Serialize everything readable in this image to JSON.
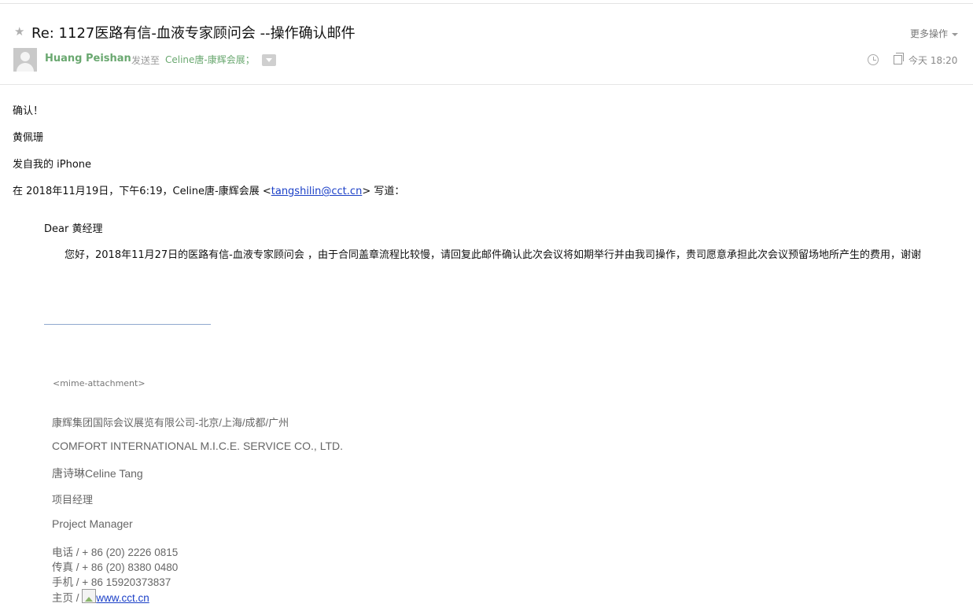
{
  "email": {
    "subject": "Re: 1127医路有信-血液专家顾问会 --操作确认邮件",
    "more_actions_label": "更多操作",
    "sender_name": "Huang Peishan",
    "sent_to_label": "发送至",
    "recipient": "Celine唐-康辉会展；",
    "time": "今天 18:20"
  },
  "body": {
    "line1": "确认！",
    "line2": "黄佩珊",
    "line3": "发自我的 iPhone",
    "reply_prefix": "在 2018年11月19日，下午6:19，Celine唐-康辉会展 <",
    "reply_email": "tangshilin@cct.cn",
    "reply_suffix": "> 写道：",
    "quote_greeting": "Dear 黄经理",
    "quote_paragraph": "您好，2018年11月27日的医路有信-血液专家顾问会 ，由于合同盖章流程比较慢，请回复此邮件确认此次会议将如期举行并由我司操作，贵司愿意承担此次会议预留场地所产生的费用，谢谢"
  },
  "signature": {
    "mime": "<mime-attachment>",
    "company_cn": "康辉集团国际会议展览有限公司-北京/上海/成都/广州",
    "company_en": "COMFORT INTERNATIONAL M.I.C.E. SERVICE CO., LTD.",
    "name": "唐诗琳Celine Tang",
    "title_cn": "项目经理",
    "title_en": "Project Manager",
    "phone": "电话 / + 86 (20) 2226 0815",
    "fax": "传真 / + 86 (20) 8380 0480",
    "mobile": "手机 / + 86 15920373837",
    "homepage_label": "主页 /",
    "homepage_link": "www.cct.cn"
  }
}
